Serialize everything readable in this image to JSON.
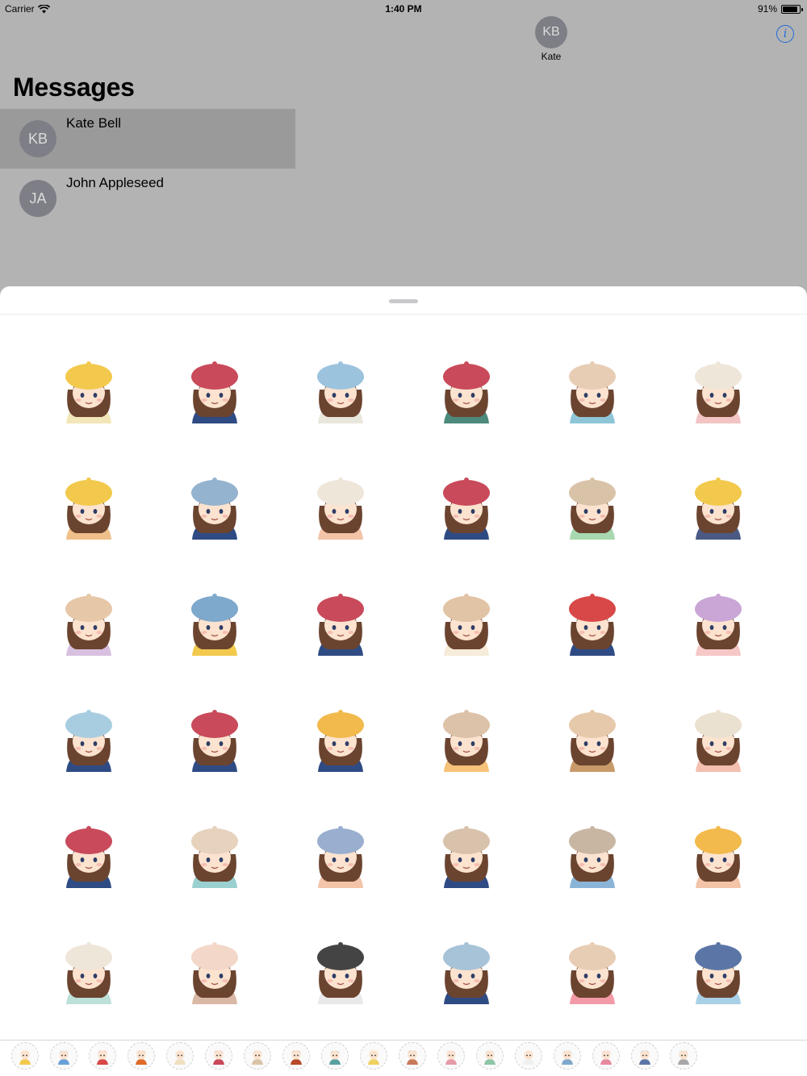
{
  "status_bar": {
    "carrier": "Carrier",
    "time": "1:40 PM",
    "battery": "91%",
    "battery_level": 0.91
  },
  "messages": {
    "title": "Messages",
    "conversations": [
      {
        "initials": "KB",
        "name": "Kate Bell",
        "selected": true
      },
      {
        "initials": "JA",
        "name": "John Appleseed",
        "selected": false
      }
    ]
  },
  "header": {
    "contact_initials": "KB",
    "contact_name": "Kate",
    "info_label": "i"
  },
  "stickers": {
    "hat_colors": [
      "#f2c94c",
      "#c94a5a",
      "#9cc3dd",
      "#c94a5a",
      "#e8cdb5",
      "#efe6da",
      "#f2c94c",
      "#94b3cf",
      "#efe6da",
      "#c94a5a",
      "#d9c3a8",
      "#f2c94c",
      "#e6c7a8",
      "#7fa9cc",
      "#c94a5a",
      "#e1c3a5",
      "#d94848",
      "#c9a6d6",
      "#a9cde0",
      "#c94a5a",
      "#f2b94c",
      "#dcc2a8",
      "#e6c9ab",
      "#ebe1d1",
      "#c94a5a",
      "#e6d2bd",
      "#9aaed0",
      "#d8c2ab",
      "#c8b6a3",
      "#f2b94c",
      "#efe6da",
      "#f3d7c8",
      "#444444",
      "#a6c3d8",
      "#e8cdb5",
      "#5b76a6"
    ],
    "outfit_colors": [
      "#f3e6b8",
      "#2f4b84",
      "#e9e6dd",
      "#4d8a7e",
      "#8ec6d8",
      "#f2c4c4",
      "#f0c08a",
      "#2f4b84",
      "#f3c4a8",
      "#2f4b84",
      "#a8d8b0",
      "#4a5a84",
      "#d8c0e0",
      "#f2c94c",
      "#2f4b84",
      "#f6ecd9",
      "#2f4b84",
      "#f6c7c7",
      "#2f4b84",
      "#2f4b84",
      "#2f4b84",
      "#f6c27a",
      "#c89a6a",
      "#f3c0b0",
      "#2f4b84",
      "#9ad0d0",
      "#f3c4a8",
      "#2f4b84",
      "#8bb5d8",
      "#f3c4a8",
      "#bde0d8",
      "#d9b9a6",
      "#e9e9e9",
      "#2f4b84",
      "#f39aa8",
      "#a8d0e6"
    ]
  },
  "tray": {
    "count": 18,
    "colors": [
      "#f2c94c",
      "#6aa0d8",
      "#d94848",
      "#e06a2a",
      "#f0e0c0",
      "#c94a5a",
      "#d9c3a8",
      "#b84a2a",
      "#5aa0a0",
      "#f0d060",
      "#c97a5a",
      "#e69aa8",
      "#8ec6a8",
      "#f0f0f0",
      "#7fa9cc",
      "#e88aa0",
      "#5b76a6",
      "#a8a8a8"
    ]
  }
}
